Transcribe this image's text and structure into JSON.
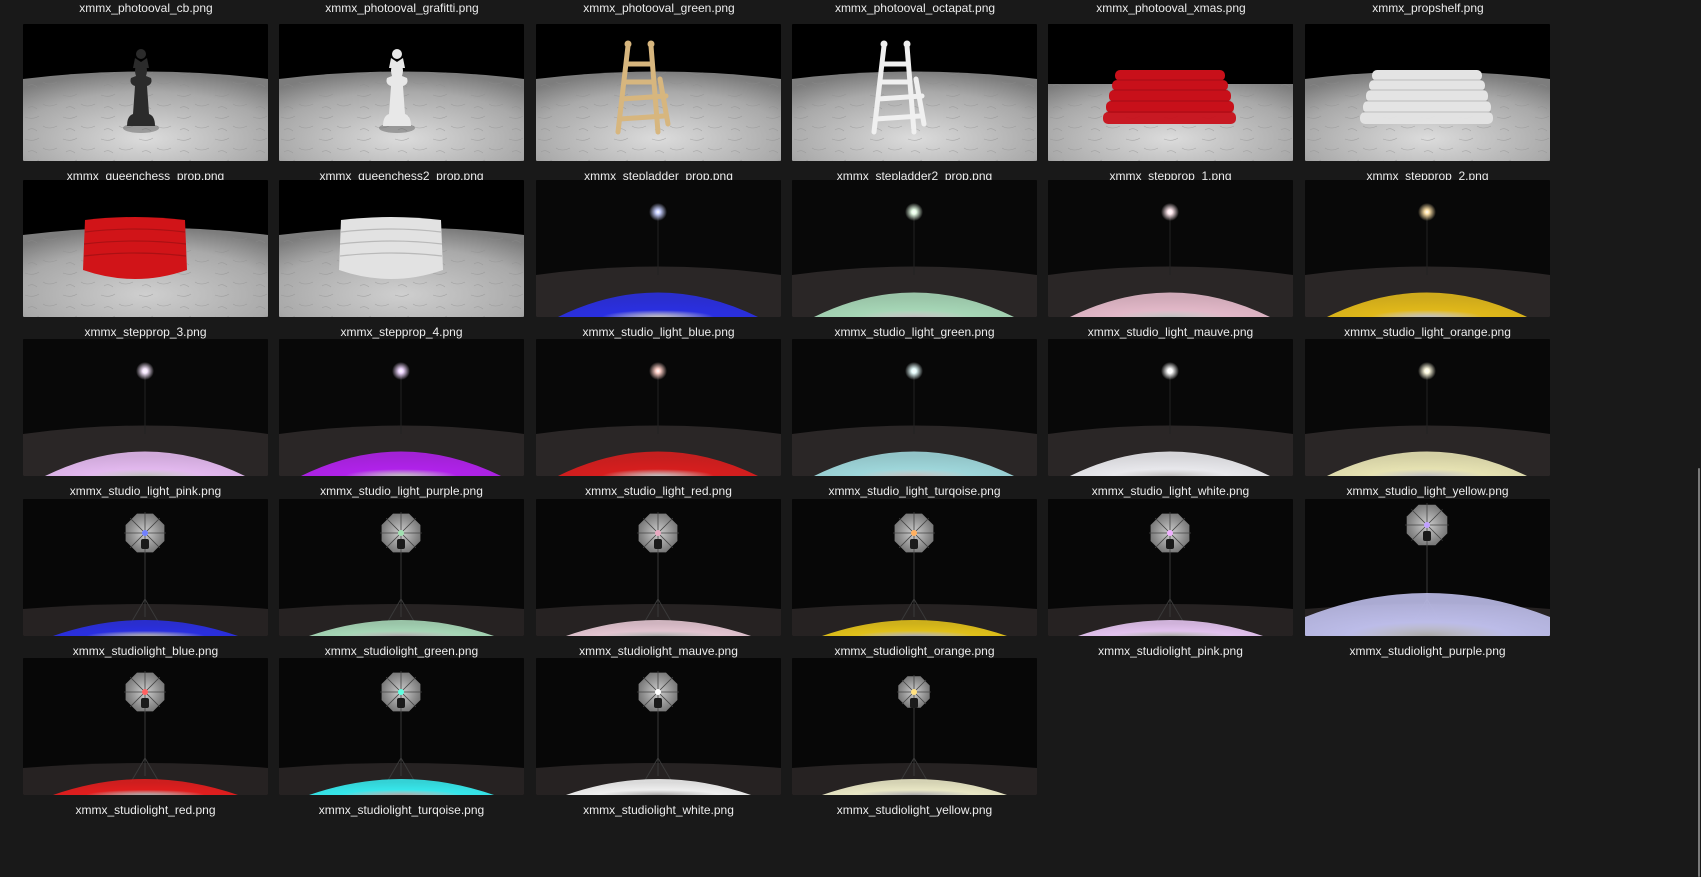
{
  "top_row": [
    "xmmx_photooval_cb.png",
    "xmmx_photooval_grafitti.png",
    "xmmx_photooval_green.png",
    "xmmx_photooval_octapat.png",
    "xmmx_photooval_xmas.png",
    "xmmx_propshelf.png"
  ],
  "files": [
    {
      "name": "xmmx_queenchess_prop.png",
      "kind": "queen",
      "color": "#2b2b2b"
    },
    {
      "name": "xmmx_queenchess2_prop.png",
      "kind": "queen",
      "color": "#e8e8e8"
    },
    {
      "name": "xmmx_stepladder_prop.png",
      "kind": "ladder",
      "color": "#d7b67e"
    },
    {
      "name": "xmmx_stepladder2_prop.png",
      "kind": "ladder",
      "color": "#f0f0f0"
    },
    {
      "name": "xmmx_stepprop_1.png",
      "kind": "step",
      "color": "#c8101a",
      "dark": true
    },
    {
      "name": "xmmx_stepprop_2.png",
      "kind": "step",
      "color": "#e4e4e4",
      "dark": false
    },
    {
      "name": "xmmx_stepprop_3.png",
      "kind": "stepround",
      "color": "#d11418"
    },
    {
      "name": "xmmx_stepprop_4.png",
      "kind": "stepround",
      "color": "#e2e2e2"
    },
    {
      "name": "xmmx_studio_light_blue.png",
      "kind": "light",
      "color": "#2a2fe0",
      "bulb": "#c8d0ff"
    },
    {
      "name": "xmmx_studio_light_green.png",
      "kind": "light",
      "color": "#a6d6b6",
      "bulb": "#e8ffe8"
    },
    {
      "name": "xmmx_studio_light_mauve.png",
      "kind": "light",
      "color": "#e2b8c8",
      "bulb": "#ffe8ee"
    },
    {
      "name": "xmmx_studio_light_orange.png",
      "kind": "light",
      "color": "#e0b81a",
      "bulb": "#ffe2a8"
    },
    {
      "name": "xmmx_studio_light_pink.png",
      "kind": "light",
      "color": "#e2b8ee",
      "bulb": "#f8e8ff"
    },
    {
      "name": "xmmx_studio_light_purple.png",
      "kind": "light",
      "color": "#b022ea",
      "bulb": "#f0d8ff"
    },
    {
      "name": "xmmx_studio_light_red.png",
      "kind": "light",
      "color": "#d61e1e",
      "bulb": "#ffd0c8"
    },
    {
      "name": "xmmx_studio_light_turqoise.png",
      "kind": "light",
      "color": "#9ed6da",
      "bulb": "#e8ffff"
    },
    {
      "name": "xmmx_studio_light_white.png",
      "kind": "light",
      "color": "#e8e8ec",
      "bulb": "#ffffff"
    },
    {
      "name": "xmmx_studio_light_yellow.png",
      "kind": "light",
      "color": "#e6e2b2",
      "bulb": "#fffbe0"
    },
    {
      "name": "xmmx_studiolight_blue.png",
      "kind": "umbrella",
      "color": "#2a2fe0",
      "bulb": "#7080ff"
    },
    {
      "name": "xmmx_studiolight_green.png",
      "kind": "umbrella",
      "color": "#a6d6b6",
      "bulb": "#a0e0b0"
    },
    {
      "name": "xmmx_studiolight_mauve.png",
      "kind": "umbrella",
      "color": "#e2c4d0",
      "bulb": "#e8a8c0"
    },
    {
      "name": "xmmx_studiolight_orange.png",
      "kind": "umbrella",
      "color": "#e0c01a",
      "bulb": "#ffb060"
    },
    {
      "name": "xmmx_studiolight_pink.png",
      "kind": "umbrella",
      "color": "#e2c2ee",
      "bulb": "#f0b0ff"
    },
    {
      "name": "xmmx_studiolight_purple.png",
      "kind": "umbrella",
      "color": "#bcbce8",
      "bulb": "#c0a0ff",
      "big": true
    },
    {
      "name": "xmmx_studiolight_red.png",
      "kind": "umbrella",
      "color": "#e01e1e",
      "bulb": "#ff6060"
    },
    {
      "name": "xmmx_studiolight_turqoise.png",
      "kind": "umbrella",
      "color": "#36e6ea",
      "bulb": "#60ffe0"
    },
    {
      "name": "xmmx_studiolight_white.png",
      "kind": "umbrella",
      "color": "#eeeeee",
      "bulb": "#ffffff"
    },
    {
      "name": "xmmx_studiolight_yellow.png",
      "kind": "umbrella",
      "color": "#e8e6c4",
      "bulb": "#ffe080",
      "small": true
    }
  ]
}
